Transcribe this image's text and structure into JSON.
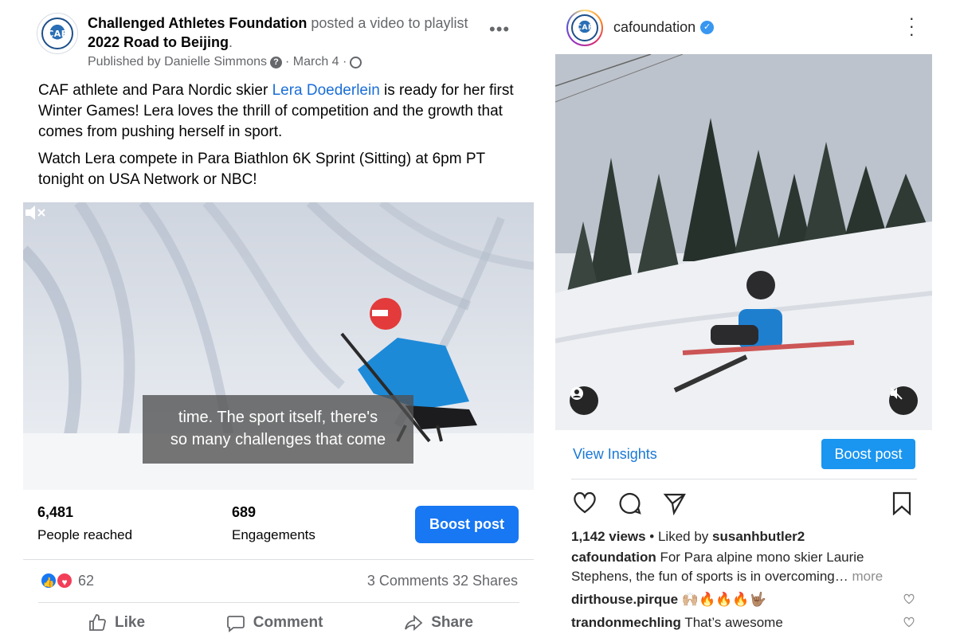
{
  "facebook": {
    "page_name": "Challenged Athletes Foundation",
    "action_text": "posted a video to playlist",
    "playlist_name": "2022 Road to Beijing",
    "period": ".",
    "published_by": "Published by Danielle Simmons",
    "date": "· March 4 ·",
    "avatar_text": "CAF",
    "body_p1_before": "CAF athlete and Para Nordic skier ",
    "body_p1_link": "Lera Doederlein",
    "body_p1_after": " is ready for her first Winter Games! Lera loves the thrill of competition and the growth that comes from pushing herself in sport.",
    "body_p2": "Watch Lera compete in Para Biathlon 6K Sprint (Sitting) at 6pm PT tonight on USA Network or NBC!",
    "caption_line1": "time. The sport itself, there's",
    "caption_line2": "so many challenges that come",
    "people_reached_value": "6,481",
    "people_reached_label": "People reached",
    "engagements_value": "689",
    "engagements_label": "Engagements",
    "boost_label": "Boost post",
    "reaction_count": "62",
    "comments_shares": "3 Comments  32 Shares",
    "like_label": "Like",
    "comment_label": "Comment",
    "share_label": "Share"
  },
  "instagram": {
    "username": "cafoundation",
    "avatar_text": "CAF",
    "view_insights_label": "View Insights",
    "boost_label": "Boost post",
    "views": "1,142 views",
    "liked_by_prefix": " • Liked by ",
    "liked_by_user": "susanhbutler2",
    "caption_user": "cafoundation",
    "caption_text": " For Para alpine mono skier Laurie Stephens, the fun of sports is in overcoming…",
    "more_label": " more",
    "comments": [
      {
        "user": "dirthouse.pirque",
        "text": " 🙌🏼🔥🔥🔥🤟🏽"
      },
      {
        "user": "trandonmechling",
        "text": " That’s awesome"
      }
    ]
  }
}
